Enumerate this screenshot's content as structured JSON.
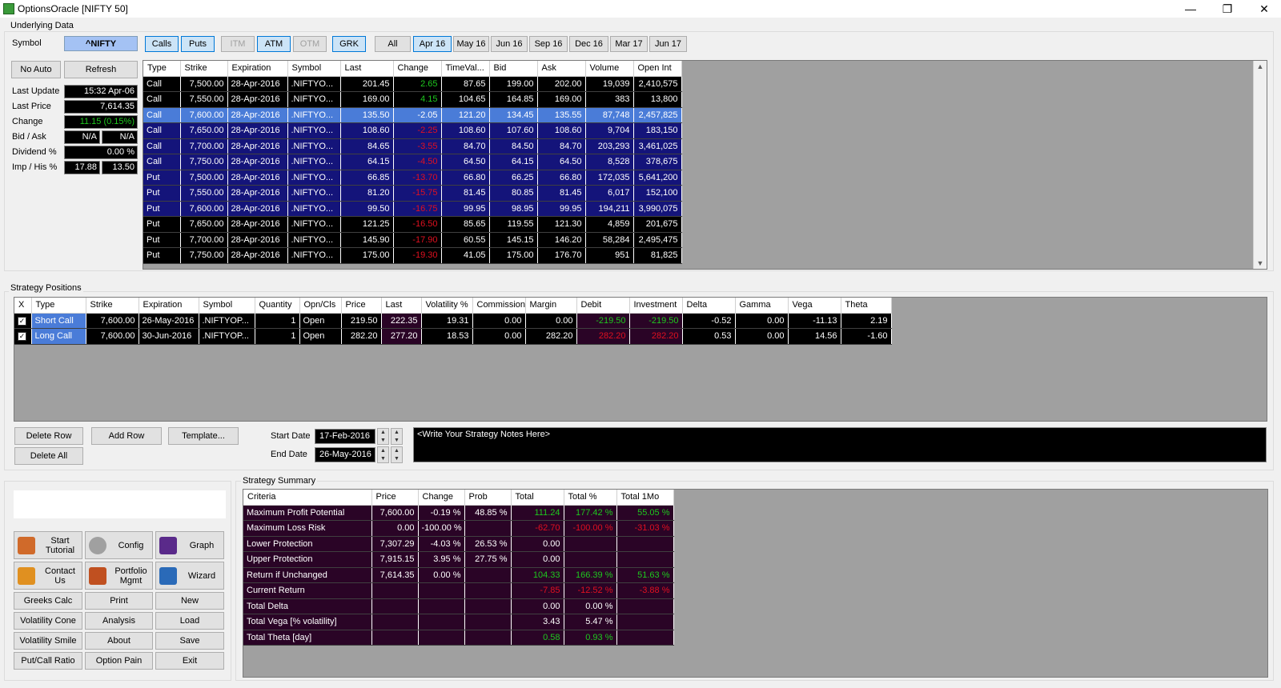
{
  "window": {
    "title": "OptionsOracle [NIFTY 50]",
    "minimize": "—",
    "restore": "❐",
    "close": "✕"
  },
  "underlying": {
    "group_label": "Underlying Data",
    "symbol_label": "Symbol",
    "symbol_value": "^NIFTY",
    "no_auto": "No Auto",
    "refresh": "Refresh",
    "last_update_label": "Last Update",
    "last_update": "15:32 Apr-06",
    "last_price_label": "Last Price",
    "last_price": "7,614.35",
    "change_label": "Change",
    "change": "11.15 (0.15%)",
    "bidask_label": "Bid / Ask",
    "bid": "N/A",
    "ask": "N/A",
    "dividend_label": "Dividend %",
    "dividend": "0.00 %",
    "imphis_label": "Imp / His %",
    "imp": "17.88",
    "his": "13.50"
  },
  "filters": {
    "calls": "Calls",
    "puts": "Puts",
    "itm": "ITM",
    "atm": "ATM",
    "otm": "OTM",
    "grk": "GRK",
    "all": "All",
    "apr16": "Apr 16",
    "may16": "May 16",
    "jun16": "Jun 16",
    "sep16": "Sep 16",
    "dec16": "Dec 16",
    "mar17": "Mar 17",
    "jun17": "Jun 17"
  },
  "options_table": {
    "headers": [
      "Type",
      "Strike",
      "Expiration",
      "Symbol",
      "Last",
      "Change",
      "TimeVal...",
      "Bid",
      "Ask",
      "Volume",
      "Open Int"
    ],
    "rows": [
      {
        "cells": [
          "Call",
          "7,500.00",
          "28-Apr-2016",
          ".NIFTYO...",
          "201.45",
          "2.65",
          "87.65",
          "199.00",
          "202.00",
          "19,039",
          "2,410,575"
        ],
        "style": "blk",
        "chg": "g"
      },
      {
        "cells": [
          "Call",
          "7,550.00",
          "28-Apr-2016",
          ".NIFTYO...",
          "169.00",
          "4.15",
          "104.65",
          "164.85",
          "169.00",
          "383",
          "13,800"
        ],
        "style": "blk",
        "chg": "g"
      },
      {
        "cells": [
          "Call",
          "7,600.00",
          "28-Apr-2016",
          ".NIFTYO...",
          "135.50",
          "-2.05",
          "121.20",
          "134.45",
          "135.55",
          "87,748",
          "2,457,825"
        ],
        "style": "hl",
        "chg": "w"
      },
      {
        "cells": [
          "Call",
          "7,650.00",
          "28-Apr-2016",
          ".NIFTYO...",
          "108.60",
          "-2.25",
          "108.60",
          "107.60",
          "108.60",
          "9,704",
          "183,150"
        ],
        "style": "blu",
        "chg": "rd"
      },
      {
        "cells": [
          "Call",
          "7,700.00",
          "28-Apr-2016",
          ".NIFTYO...",
          "84.65",
          "-3.55",
          "84.70",
          "84.50",
          "84.70",
          "203,293",
          "3,461,025"
        ],
        "style": "blu",
        "chg": "rd"
      },
      {
        "cells": [
          "Call",
          "7,750.00",
          "28-Apr-2016",
          ".NIFTYO...",
          "64.15",
          "-4.50",
          "64.50",
          "64.15",
          "64.50",
          "8,528",
          "378,675"
        ],
        "style": "blu",
        "chg": "rd"
      },
      {
        "cells": [
          "Put",
          "7,500.00",
          "28-Apr-2016",
          ".NIFTYO...",
          "66.85",
          "-13.70",
          "66.80",
          "66.25",
          "66.80",
          "172,035",
          "5,641,200"
        ],
        "style": "blu",
        "chg": "rd"
      },
      {
        "cells": [
          "Put",
          "7,550.00",
          "28-Apr-2016",
          ".NIFTYO...",
          "81.20",
          "-15.75",
          "81.45",
          "80.85",
          "81.45",
          "6,017",
          "152,100"
        ],
        "style": "blu",
        "chg": "rd"
      },
      {
        "cells": [
          "Put",
          "7,600.00",
          "28-Apr-2016",
          ".NIFTYO...",
          "99.50",
          "-16.75",
          "99.95",
          "98.95",
          "99.95",
          "194,211",
          "3,990,075"
        ],
        "style": "blu",
        "chg": "rd"
      },
      {
        "cells": [
          "Put",
          "7,650.00",
          "28-Apr-2016",
          ".NIFTYO...",
          "121.25",
          "-16.50",
          "85.65",
          "119.55",
          "121.30",
          "4,859",
          "201,675"
        ],
        "style": "blk",
        "chg": "rd"
      },
      {
        "cells": [
          "Put",
          "7,700.00",
          "28-Apr-2016",
          ".NIFTYO...",
          "145.90",
          "-17.90",
          "60.55",
          "145.15",
          "146.20",
          "58,284",
          "2,495,475"
        ],
        "style": "blk",
        "chg": "rd"
      },
      {
        "cells": [
          "Put",
          "7,750.00",
          "28-Apr-2016",
          ".NIFTYO...",
          "175.00",
          "-19.30",
          "41.05",
          "175.00",
          "176.70",
          "951",
          "81,825"
        ],
        "style": "blk",
        "chg": "rd"
      }
    ]
  },
  "positions": {
    "group_label": "Strategy Positions",
    "headers": [
      "X",
      "Type",
      "Strike",
      "Expiration",
      "Symbol",
      "Quantity",
      "Opn/Cls",
      "Price",
      "Last",
      "Volatility %",
      "Commission",
      "Margin",
      "Debit",
      "Investment",
      "Delta",
      "Gamma",
      "Vega",
      "Theta"
    ],
    "rows": [
      {
        "check": "✓",
        "cells": [
          "Short Call",
          "7,600.00",
          "26-May-2016",
          ".NIFTYOP...",
          "1",
          "Open",
          "219.50",
          "222.35",
          "19.31",
          "0.00",
          "0.00",
          "-219.50",
          "-219.50",
          "-0.52",
          "0.00",
          "-11.13",
          "2.19"
        ],
        "debit_color": "g",
        "inv_color": "g"
      },
      {
        "check": "✓",
        "cells": [
          "Long Call",
          "7,600.00",
          "30-Jun-2016",
          ".NIFTYOP...",
          "1",
          "Open",
          "282.20",
          "277.20",
          "18.53",
          "0.00",
          "282.20",
          "282.20",
          "282.20",
          "0.53",
          "0.00",
          "14.56",
          "-1.60"
        ],
        "debit_color": "rd",
        "inv_color": "rd"
      }
    ],
    "delete_row": "Delete Row",
    "add_row": "Add Row",
    "template": "Template...",
    "delete_all": "Delete All",
    "start_date_label": "Start Date",
    "start_date": "17-Feb-2016",
    "end_date_label": "End Date",
    "end_date": "26-May-2016",
    "notes": "<Write Your Strategy Notes Here>"
  },
  "tools": {
    "start_tutorial": "Start Tutorial",
    "config": "Config",
    "graph": "Graph",
    "contact_us": "Contact Us",
    "portfolio_mgmt": "Portfolio Mgmt",
    "wizard": "Wizard",
    "greeks_calc": "Greeks Calc",
    "print": "Print",
    "new": "New",
    "volatility_cone": "Volatility Cone",
    "analysis": "Analysis",
    "load": "Load",
    "volatility_smile": "Volatility Smile",
    "about": "About",
    "save": "Save",
    "put_call_ratio": "Put/Call Ratio",
    "option_pain": "Option Pain",
    "exit": "Exit"
  },
  "summary": {
    "group_label": "Strategy Summary",
    "headers": [
      "Criteria",
      "Price",
      "Change",
      "Prob",
      "Total",
      "Total %",
      "Total 1Mo"
    ],
    "rows": [
      {
        "cells": [
          "Maximum Profit Potential",
          "7,600.00",
          "-0.19 %",
          "48.85 %",
          "111.24",
          "177.42 %",
          "55.05 %"
        ],
        "colors": [
          "",
          "",
          "",
          "",
          "g",
          "g",
          "g"
        ]
      },
      {
        "cells": [
          "Maximum Loss Risk",
          "0.00",
          "-100.00 %",
          "",
          "-62.70",
          "-100.00 %",
          "-31.03 %"
        ],
        "colors": [
          "",
          "",
          "",
          "",
          "rd",
          "rd",
          "rd"
        ]
      },
      {
        "cells": [
          "Lower Protection",
          "7,307.29",
          "-4.03 %",
          "26.53 %",
          "0.00",
          "",
          ""
        ],
        "colors": [
          "",
          "",
          "",
          "",
          "",
          "",
          ""
        ]
      },
      {
        "cells": [
          "Upper Protection",
          "7,915.15",
          "3.95 %",
          "27.75 %",
          "0.00",
          "",
          ""
        ],
        "colors": [
          "",
          "",
          "",
          "",
          "",
          "",
          ""
        ]
      },
      {
        "cells": [
          "Return if Unchanged",
          "7,614.35",
          "0.00 %",
          "",
          "104.33",
          "166.39 %",
          "51.63 %"
        ],
        "colors": [
          "",
          "",
          "",
          "",
          "g",
          "g",
          "g"
        ]
      },
      {
        "cells": [
          "Current Return",
          "",
          "",
          "",
          "-7.85",
          "-12.52 %",
          "-3.88 %"
        ],
        "colors": [
          "",
          "",
          "",
          "",
          "rd",
          "rd",
          "rd"
        ]
      },
      {
        "cells": [
          "Total Delta",
          "",
          "",
          "",
          "0.00",
          "0.00 %",
          ""
        ],
        "colors": [
          "",
          "",
          "",
          "",
          "",
          "",
          ""
        ]
      },
      {
        "cells": [
          "Total Vega [% volatility]",
          "",
          "",
          "",
          "3.43",
          "5.47 %",
          ""
        ],
        "colors": [
          "",
          "",
          "",
          "",
          "",
          "",
          ""
        ]
      },
      {
        "cells": [
          "Total Theta [day]",
          "",
          "",
          "",
          "0.58",
          "0.93 %",
          ""
        ],
        "colors": [
          "",
          "",
          "",
          "",
          "g",
          "g",
          ""
        ]
      }
    ]
  },
  "colors": {
    "green": "#1ec81e",
    "red": "#e01020",
    "purple_row": "#2a0426",
    "blue_row": "#14147a",
    "highlight": "#4a7cd8"
  }
}
